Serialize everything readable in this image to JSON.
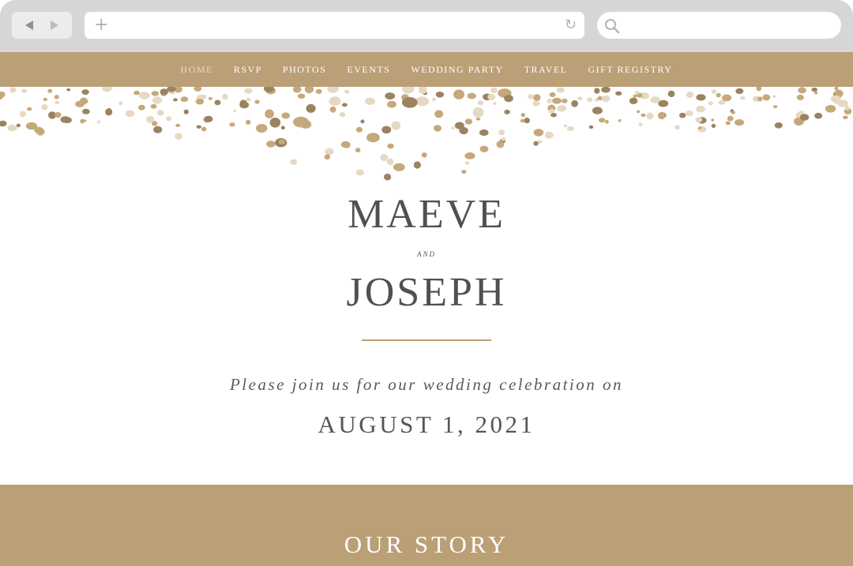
{
  "browser": {
    "back_icon": "back-arrow-icon",
    "forward_icon": "forward-arrow-icon",
    "new_tab_icon": "plus-icon",
    "reload_icon": "reload-icon",
    "search_icon": "search-icon",
    "address_value": "",
    "search_value": ""
  },
  "nav": {
    "items": [
      {
        "label": "HOME",
        "active": true
      },
      {
        "label": "RSVP"
      },
      {
        "label": "PHOTOS"
      },
      {
        "label": "EVENTS"
      },
      {
        "label": "WEDDING PARTY"
      },
      {
        "label": "TRAVEL"
      },
      {
        "label": "GIFT REGISTRY"
      }
    ]
  },
  "hero": {
    "name1": "MAEVE",
    "conjunction": "AND",
    "name2": "JOSEPH",
    "invite": "Please join us for our wedding celebration on",
    "date": "AUGUST 1, 2021"
  },
  "story": {
    "title": "OUR STORY"
  },
  "colors": {
    "accent": "#bb9f77",
    "text": "#505050",
    "chrome": "#d6d6d6",
    "confetti_light": "#e6d9c4",
    "confetti_gold": "#c6a97b",
    "confetti_dark": "#9b8360"
  }
}
